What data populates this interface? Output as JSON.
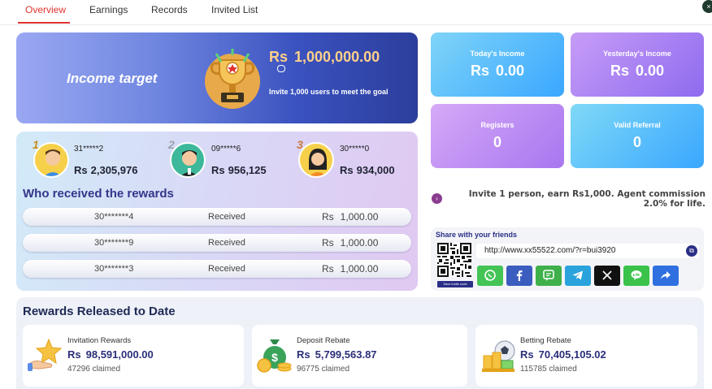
{
  "tabs": [
    "Overview",
    "Earnings",
    "Records",
    "Invited List"
  ],
  "close_icon": "×",
  "currency": "Rs",
  "income_target": {
    "title": "Income target",
    "amount": "1,000,000.00",
    "description": "Invite 1,000 users to meet the goal"
  },
  "stats": {
    "today": {
      "label": "Today's Income",
      "value": "0.00"
    },
    "yesterday": {
      "label": "Yesterday's Income",
      "value": "0.00"
    },
    "registers": {
      "label": "Registers",
      "value": "0"
    },
    "valid_referral": {
      "label": "Valid Referral",
      "value": "0"
    }
  },
  "top_users": [
    {
      "rank": "1",
      "id": "31*****2",
      "amount": "2,305,976"
    },
    {
      "rank": "2",
      "id": "09*****6",
      "amount": "956,125"
    },
    {
      "rank": "3",
      "id": "30*****0",
      "amount": "934,000"
    }
  ],
  "rewards": {
    "title": "Who received the rewards",
    "rows": [
      {
        "id": "30*******4",
        "status": "Received",
        "amount": "1,000.00"
      },
      {
        "id": "30*******9",
        "status": "Received",
        "amount": "1,000.00"
      },
      {
        "id": "30*******3",
        "status": "Received",
        "amount": "1,000.00"
      }
    ]
  },
  "invite": {
    "text": "Invite 1 person, earn Rs1,000. Agent commission 2.0% for life."
  },
  "share": {
    "title": "Share with your friends",
    "qr_button": "Save invite code",
    "url": "http://www.xx55522.com/?r=bui3920",
    "socials": [
      {
        "name": "whatsapp",
        "color": "#43c455",
        "glyph": "✆"
      },
      {
        "name": "facebook",
        "color": "#3b5dbf",
        "glyph": "f"
      },
      {
        "name": "sms",
        "color": "#3fb04a",
        "glyph": "▤"
      },
      {
        "name": "telegram",
        "color": "#2aa3dd",
        "glyph": "➤"
      },
      {
        "name": "x",
        "color": "#111111",
        "glyph": "𝕏"
      },
      {
        "name": "line",
        "color": "#3ac24a",
        "glyph": "◉"
      },
      {
        "name": "share",
        "color": "#2f6fe0",
        "glyph": "↪"
      }
    ]
  },
  "released": {
    "title": "Rewards Released to Date",
    "cards": [
      {
        "label": "Invitation Rewards",
        "amount": "98,591,000.00",
        "claimed": "47296 claimed",
        "icon": "star-hand-icon"
      },
      {
        "label": "Deposit Rebate",
        "amount": "5,799,563.87",
        "claimed": "96775 claimed",
        "icon": "money-bag-icon"
      },
      {
        "label": "Betting Rebate",
        "amount": "70,405,105.02",
        "claimed": "115785 claimed",
        "icon": "ball-coins-icon"
      }
    ]
  }
}
